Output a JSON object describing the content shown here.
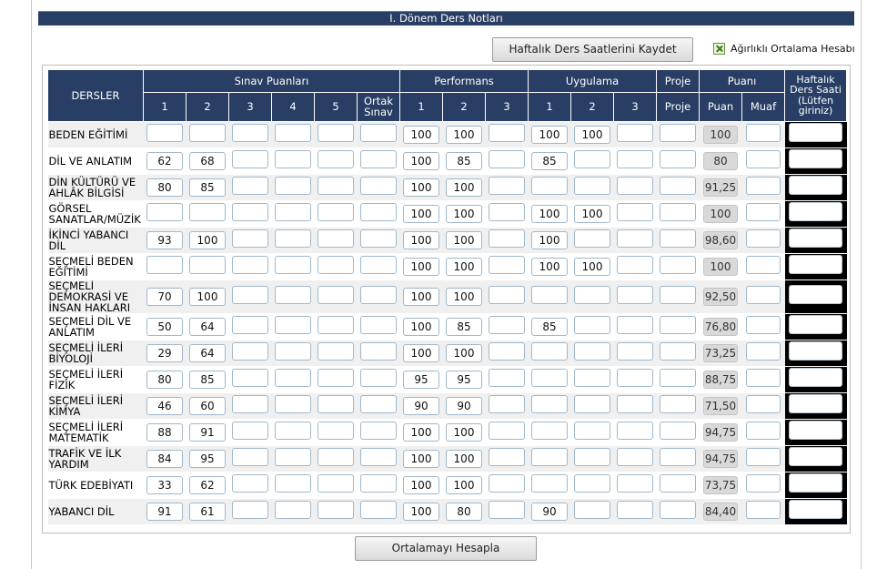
{
  "title": "I. Dönem Ders Notları",
  "save_button": "Haftalık Ders Saatlerini Kaydet",
  "weighted_label": "Ağırlıklı Ortalama Hesabı",
  "calc_button": "Ortalamayı Hesapla",
  "headers": {
    "courses": "DERSLER",
    "exam_group": "Sınav Puanları",
    "performance_group": "Performans",
    "practice_group": "Uygulama",
    "project_group": "Proje",
    "score_group": "Puanı",
    "hours": "Haftalık Ders Saati (Lütfen giriniz)",
    "exam_cols": [
      "1",
      "2",
      "3",
      "4",
      "5",
      "Ortak Sınav"
    ],
    "performance_cols": [
      "1",
      "2",
      "3"
    ],
    "practice_cols": [
      "1",
      "2",
      "3"
    ],
    "project_col": "Proje",
    "score_col": "Puan",
    "exempt_col": "Muaf"
  },
  "rows": [
    {
      "course": "BEDEN EĞİTİMİ",
      "exam": [
        "",
        "",
        "",
        "",
        "",
        ""
      ],
      "perf": [
        "100",
        "100",
        ""
      ],
      "prac": [
        "100",
        "100",
        ""
      ],
      "project": "",
      "avg": "100",
      "exempt": "",
      "hours": ""
    },
    {
      "course": "DİL VE ANLATIM",
      "exam": [
        "62",
        "68",
        "",
        "",
        "",
        ""
      ],
      "perf": [
        "100",
        "85",
        ""
      ],
      "prac": [
        "85",
        "",
        ""
      ],
      "project": "",
      "avg": "80",
      "exempt": "",
      "hours": ""
    },
    {
      "course": "DİN KÜLTÜRÜ VE AHLÂK BİLGİSİ",
      "exam": [
        "80",
        "85",
        "",
        "",
        "",
        ""
      ],
      "perf": [
        "100",
        "100",
        ""
      ],
      "prac": [
        "",
        "",
        ""
      ],
      "project": "",
      "avg": "91,25",
      "exempt": "",
      "hours": ""
    },
    {
      "course": "GÖRSEL SANATLAR/MÜZİK",
      "exam": [
        "",
        "",
        "",
        "",
        "",
        ""
      ],
      "perf": [
        "100",
        "100",
        ""
      ],
      "prac": [
        "100",
        "100",
        ""
      ],
      "project": "",
      "avg": "100",
      "exempt": "",
      "hours": ""
    },
    {
      "course": "İKİNCİ YABANCI DİL",
      "exam": [
        "93",
        "100",
        "",
        "",
        "",
        ""
      ],
      "perf": [
        "100",
        "100",
        ""
      ],
      "prac": [
        "100",
        "",
        ""
      ],
      "project": "",
      "avg": "98,60",
      "exempt": "",
      "hours": ""
    },
    {
      "course": "SEÇMELİ BEDEN EĞİTİMİ",
      "exam": [
        "",
        "",
        "",
        "",
        "",
        ""
      ],
      "perf": [
        "100",
        "100",
        ""
      ],
      "prac": [
        "100",
        "100",
        ""
      ],
      "project": "",
      "avg": "100",
      "exempt": "",
      "hours": ""
    },
    {
      "course": "SEÇMELİ DEMOKRASİ VE İNSAN HAKLARI",
      "exam": [
        "70",
        "100",
        "",
        "",
        "",
        ""
      ],
      "perf": [
        "100",
        "100",
        ""
      ],
      "prac": [
        "",
        "",
        ""
      ],
      "project": "",
      "avg": "92,50",
      "exempt": "",
      "hours": ""
    },
    {
      "course": "SEÇMELİ DİL VE ANLATIM",
      "exam": [
        "50",
        "64",
        "",
        "",
        "",
        ""
      ],
      "perf": [
        "100",
        "85",
        ""
      ],
      "prac": [
        "85",
        "",
        ""
      ],
      "project": "",
      "avg": "76,80",
      "exempt": "",
      "hours": ""
    },
    {
      "course": "SEÇMELİ İLERİ BİYOLOJİ",
      "exam": [
        "29",
        "64",
        "",
        "",
        "",
        ""
      ],
      "perf": [
        "100",
        "100",
        ""
      ],
      "prac": [
        "",
        "",
        ""
      ],
      "project": "",
      "avg": "73,25",
      "exempt": "",
      "hours": ""
    },
    {
      "course": "SEÇMELİ İLERİ FİZİK",
      "exam": [
        "80",
        "85",
        "",
        "",
        "",
        ""
      ],
      "perf": [
        "95",
        "95",
        ""
      ],
      "prac": [
        "",
        "",
        ""
      ],
      "project": "",
      "avg": "88,75",
      "exempt": "",
      "hours": ""
    },
    {
      "course": "SEÇMELİ İLERİ KİMYA",
      "exam": [
        "46",
        "60",
        "",
        "",
        "",
        ""
      ],
      "perf": [
        "90",
        "90",
        ""
      ],
      "prac": [
        "",
        "",
        ""
      ],
      "project": "",
      "avg": "71,50",
      "exempt": "",
      "hours": ""
    },
    {
      "course": "SEÇMELİ İLERİ MATEMATİK",
      "exam": [
        "88",
        "91",
        "",
        "",
        "",
        ""
      ],
      "perf": [
        "100",
        "100",
        ""
      ],
      "prac": [
        "",
        "",
        ""
      ],
      "project": "",
      "avg": "94,75",
      "exempt": "",
      "hours": ""
    },
    {
      "course": "TRAFİK VE İLK YARDIM",
      "exam": [
        "84",
        "95",
        "",
        "",
        "",
        ""
      ],
      "perf": [
        "100",
        "100",
        ""
      ],
      "prac": [
        "",
        "",
        ""
      ],
      "project": "",
      "avg": "94,75",
      "exempt": "",
      "hours": ""
    },
    {
      "course": "TÜRK EDEBİYATI",
      "exam": [
        "33",
        "62",
        "",
        "",
        "",
        ""
      ],
      "perf": [
        "100",
        "100",
        ""
      ],
      "prac": [
        "",
        "",
        ""
      ],
      "project": "",
      "avg": "73,75",
      "exempt": "",
      "hours": ""
    },
    {
      "course": "YABANCI DİL",
      "exam": [
        "91",
        "61",
        "",
        "",
        "",
        ""
      ],
      "perf": [
        "100",
        "80",
        ""
      ],
      "prac": [
        "90",
        "",
        ""
      ],
      "project": "",
      "avg": "84,40",
      "exempt": "",
      "hours": ""
    }
  ]
}
